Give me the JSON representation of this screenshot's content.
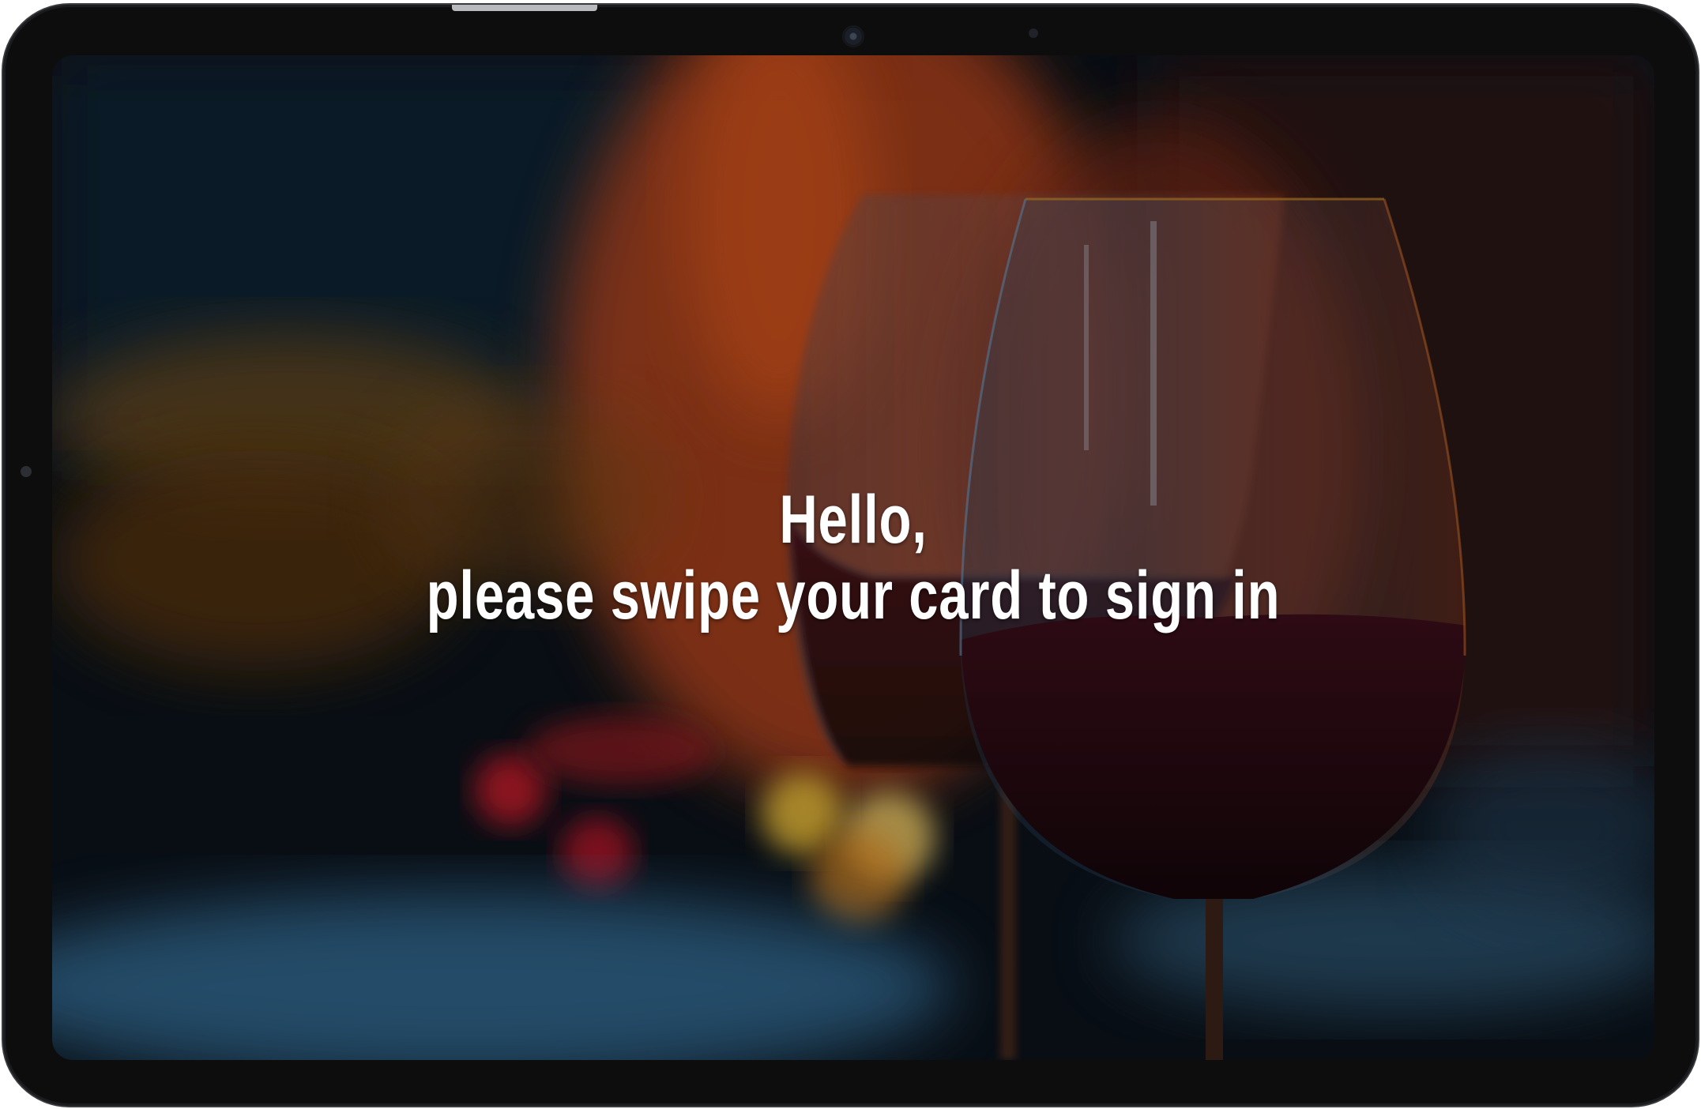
{
  "screen": {
    "greeting_line1": "Hello,",
    "greeting_line2": "please swipe your card to sign in"
  },
  "background": {
    "description_icon": "wine-glasses-by-fireplace-photo",
    "colors": {
      "dark": "#0b121a",
      "fire": "#e0601a",
      "wine": "#2a0a14",
      "glow": "#f4c64a",
      "ice": "#4a8ab8"
    }
  },
  "device": {
    "bezel_color": "#0d0d0e"
  }
}
